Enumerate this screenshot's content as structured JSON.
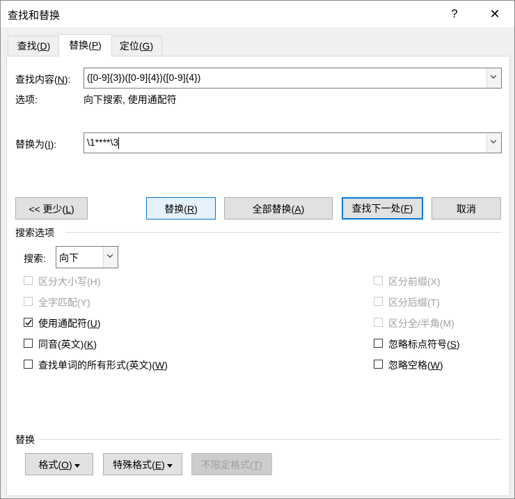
{
  "window": {
    "title": "查找和替换",
    "help_label": "?",
    "close_label": "✕"
  },
  "tabs": [
    {
      "label": "查找(",
      "key": "D",
      "suffix": ")",
      "active": false
    },
    {
      "label": "替换(",
      "key": "P",
      "suffix": ")",
      "active": true
    },
    {
      "label": "定位(",
      "key": "G",
      "suffix": ")",
      "active": false
    }
  ],
  "find": {
    "label_pre": "查找内容(",
    "key": "N",
    "label_post": "):",
    "value": "([0-9]{3})([0-9]{4})([0-9]{4})"
  },
  "options": {
    "label": "选项:",
    "value": "向下搜索, 使用通配符"
  },
  "replace": {
    "label_pre": "替换为(",
    "key": "I",
    "label_post": "):",
    "value": "\\1****\\3"
  },
  "buttons": {
    "less": {
      "pre": "<< 更少(",
      "key": "L",
      "post": ")"
    },
    "replace": {
      "pre": "替换(",
      "key": "R",
      "post": ")"
    },
    "replace_all": {
      "pre": "全部替换(",
      "key": "A",
      "post": ")"
    },
    "find_next": {
      "pre": "查找下一处(",
      "key": "F",
      "post": ")"
    },
    "cancel": "取消"
  },
  "search_options": {
    "heading": "搜索选项",
    "search_label": "搜索:",
    "direction": "向下"
  },
  "checkboxes_left": [
    {
      "pre": "区分大小写(H)",
      "key": "",
      "post": "",
      "checked": false,
      "disabled": true
    },
    {
      "pre": "全字匹配(Y)",
      "key": "",
      "post": "",
      "checked": false,
      "disabled": true
    },
    {
      "pre": "使用通配符(",
      "key": "U",
      "post": ")",
      "checked": true,
      "disabled": false
    },
    {
      "pre": "同音(英文)(",
      "key": "K",
      "post": ")",
      "checked": false,
      "disabled": false
    },
    {
      "pre": "查找单词的所有形式(英文)(",
      "key": "W",
      "post": ")",
      "checked": false,
      "disabled": false
    }
  ],
  "checkboxes_right": [
    {
      "pre": "区分前缀(X)",
      "key": "",
      "post": "",
      "checked": false,
      "disabled": true
    },
    {
      "pre": "区分后缀(T)",
      "key": "",
      "post": "",
      "checked": false,
      "disabled": true
    },
    {
      "pre": "区分全/半角(M)",
      "key": "",
      "post": "",
      "checked": false,
      "disabled": true
    },
    {
      "pre": "忽略标点符号(",
      "key": "S",
      "post": ")",
      "checked": false,
      "disabled": false
    },
    {
      "pre": "忽略空格(",
      "key": "W",
      "post": ")",
      "checked": false,
      "disabled": false
    }
  ],
  "replace_section": {
    "heading": "替换",
    "format": {
      "pre": "格式(",
      "key": "O",
      "post": ")"
    },
    "special": {
      "pre": "特殊格式(",
      "key": "E",
      "post": ")"
    },
    "no_format": {
      "pre": "不限定格式(",
      "key": "T",
      "post": ")"
    }
  },
  "colors": {
    "accent": "#0078d7",
    "dialog_bg": "#f0f0f0",
    "button_bg": "#e1e1e1",
    "disabled_text": "#a0a0a0"
  }
}
